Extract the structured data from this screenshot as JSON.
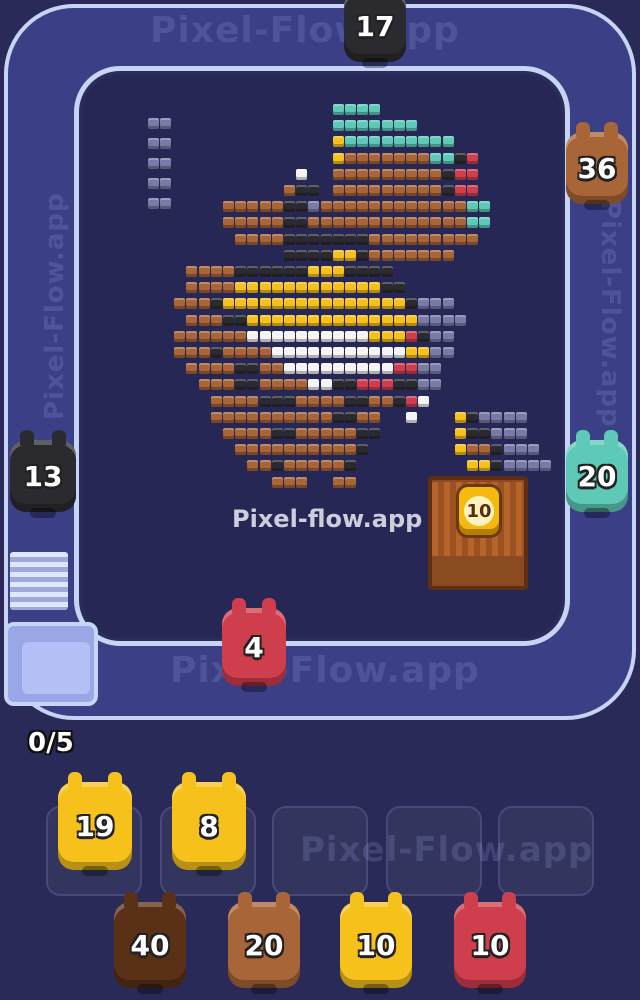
{
  "watermarks": {
    "top": "Pixel-Flow.app",
    "bottom": "Pixel-Flow.app",
    "center": "Pixel-flow.app",
    "side": "Pixel-Flow.app",
    "slots": "Pixel-Flow.app"
  },
  "progress": "0/5",
  "colors": {
    "black": "#2b2b2f",
    "brown": "#a86537",
    "dark_brown": "#5a3016",
    "teal": "#5fc9b8",
    "yellow": "#f6c11a",
    "red": "#cf3e4d",
    "white": "#f4f4f4",
    "purple_gray": "#7a7aa6"
  },
  "conveyor_shooters": [
    {
      "id": "top",
      "count": "17",
      "color": "black"
    },
    {
      "id": "right-top",
      "count": "36",
      "color": "brown"
    },
    {
      "id": "left",
      "count": "13",
      "color": "black"
    },
    {
      "id": "right-mid",
      "count": "20",
      "color": "teal"
    },
    {
      "id": "bottom",
      "count": "4",
      "color": "red"
    }
  ],
  "mystery_box": {
    "count": "10",
    "color": "yellow"
  },
  "slots": [
    {
      "count": "19",
      "color": "yellow",
      "filled": true
    },
    {
      "count": "8",
      "color": "yellow",
      "filled": true
    },
    {
      "filled": false
    },
    {
      "filled": false
    },
    {
      "filled": false
    }
  ],
  "queue": [
    {
      "count": "40",
      "color": "dark_brown"
    },
    {
      "count": "20",
      "color": "brown"
    },
    {
      "count": "10",
      "color": "yellow"
    },
    {
      "count": "10",
      "color": "red"
    }
  ]
}
